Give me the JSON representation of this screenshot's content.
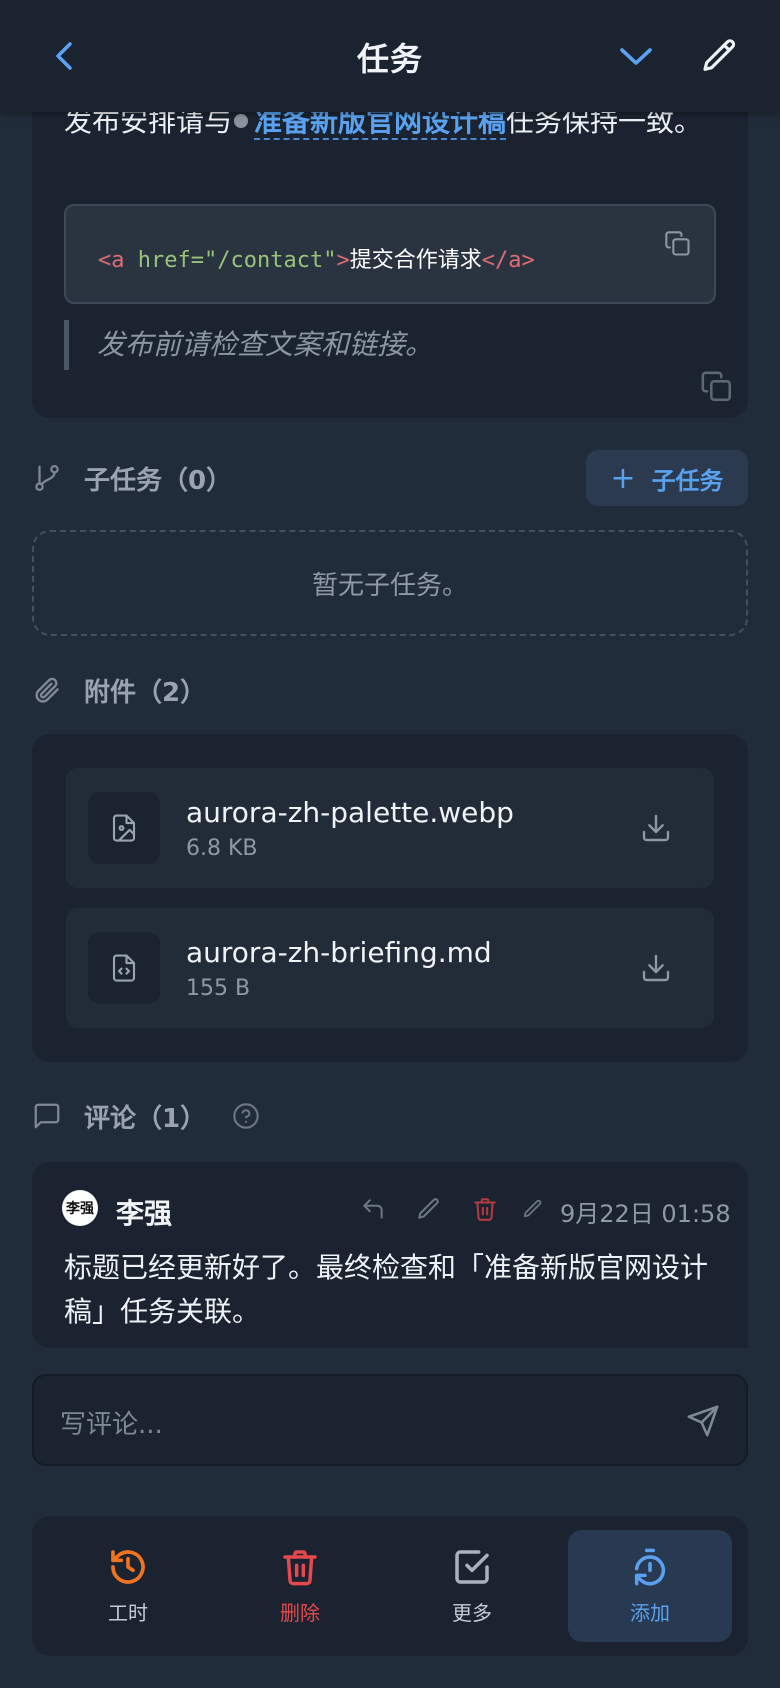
{
  "header": {
    "title": "任务"
  },
  "description": {
    "text_before": "发布安排请与",
    "link_text": "准备新版官网设计稿",
    "text_after": "任务保持一致。",
    "code": {
      "open_tag_start": "<a",
      "attr": " href=",
      "value": "\"/contact\"",
      "open_tag_end": ">",
      "inner": "提交合作请求",
      "close_tag": "</a>"
    },
    "quote": "发布前请检查文案和链接。"
  },
  "subtasks": {
    "heading": "子任务（0）",
    "add_label": "子任务",
    "empty_text": "暂无子任务。"
  },
  "attachments": {
    "heading": "附件（2）",
    "items": [
      {
        "name": "aurora-zh-palette.webp",
        "size": "6.8 KB",
        "icon": "image-file-icon"
      },
      {
        "name": "aurora-zh-briefing.md",
        "size": "155 B",
        "icon": "code-file-icon"
      }
    ]
  },
  "comments": {
    "heading": "评论（1）",
    "items": [
      {
        "author": "李强",
        "avatar_text": "李强",
        "time": "9月22日 01:58",
        "body": "标题已经更新好了。最终检查和「准备新版官网设计稿」任务关联。"
      }
    ],
    "input_placeholder": "写评论..."
  },
  "toolbar": {
    "worklog_label": "工时",
    "delete_label": "删除",
    "more_label": "更多",
    "add_label": "添加"
  },
  "colors": {
    "background": "#212c3a",
    "card": "#1a232f",
    "accent": "#5aa2f0",
    "danger": "#e5484d",
    "worklog": "#f0731f"
  }
}
